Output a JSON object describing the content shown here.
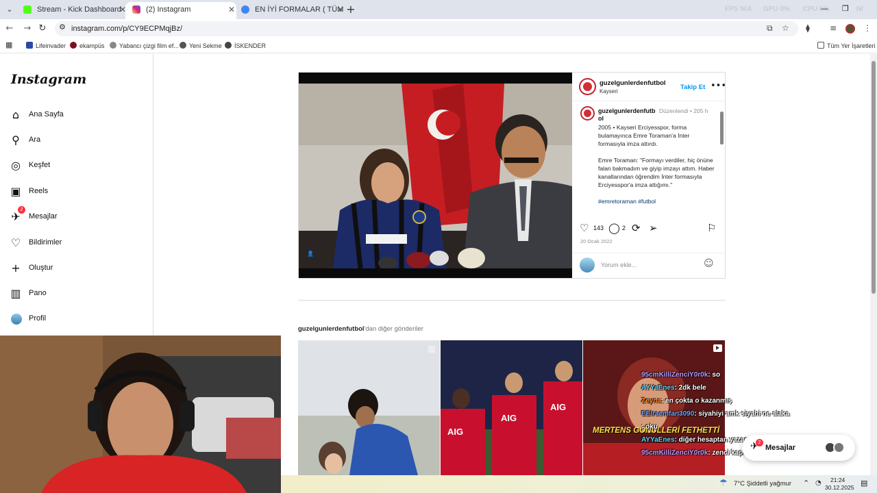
{
  "browser": {
    "tabs": [
      {
        "title": "Stream - Kick Dashboard",
        "active": false,
        "favicon_color": "#53fc18"
      },
      {
        "title": "(2) Instagram",
        "active": true,
        "favicon_color": "#d6249f"
      },
      {
        "title": "EN İYİ FORMALAR ( TÜM TAKIM",
        "active": false,
        "favicon_color": "#4285f4"
      }
    ],
    "sysmon": {
      "fps_label": "FPS",
      "fps": "N/A",
      "gpu_label": "GPU",
      "gpu": "0%",
      "cpu_label": "CPU",
      "cpu": "6%",
      "extra": "N/"
    },
    "url": "instagram.com/p/CY9ECPMqjBz/",
    "bookmarks": [
      "Lifeinvader",
      "ekampüs",
      "Yabancı çizgi film ef...",
      "Yeni Sekme",
      "İSKENDER"
    ],
    "all_bookmarks": "Tüm Yer İşaretleri"
  },
  "sidebar": {
    "logo": "Instagram",
    "items": [
      {
        "label": "Ana Sayfa",
        "icon": "home-icon",
        "glyph": "⌂"
      },
      {
        "label": "Ara",
        "icon": "search-icon",
        "glyph": "⚲"
      },
      {
        "label": "Keşfet",
        "icon": "compass-icon",
        "glyph": "◎"
      },
      {
        "label": "Reels",
        "icon": "reels-icon",
        "glyph": "▣"
      },
      {
        "label": "Mesajlar",
        "icon": "messenger-icon",
        "glyph": "✈",
        "badge": "2"
      },
      {
        "label": "Bildirimler",
        "icon": "heart-icon",
        "glyph": "♡"
      },
      {
        "label": "Oluştur",
        "icon": "plus-icon",
        "glyph": "+"
      },
      {
        "label": "Pano",
        "icon": "dashboard-icon",
        "glyph": "▥"
      },
      {
        "label": "Profil",
        "icon": "profile-avatar",
        "glyph": ""
      }
    ]
  },
  "post": {
    "username": "guzelgunlerdenfutbol",
    "location": "Kayseri",
    "follow": "Takip Et",
    "caption_user": "guzelgunlerdenfutbol",
    "caption_edited": "Düzenlendi",
    "caption_age": "205 h",
    "caption": "2005 • Kayseri Erciyesspor, forma bulamayınca Emre Toraman'a İnter formasıyla imza attırdı.\n\nEmre Toraman: \"Formayı verdiler, hiç önüne falan bakmadım ve giyip imzayı attım. Haber kanallarından öğrendim İnter formasıyla Erciyesspor'a imza attığımı.\"",
    "tags": "#emretoraman #futbol",
    "likes": "143",
    "comments": "2",
    "date": "20 Ocak 2022",
    "comment_placeholder": "Yorum ekle..."
  },
  "more": {
    "user": "guzelgunlerdenfutbol",
    "suffix": "'dan diğer gönderiler"
  },
  "chat": [
    {
      "user": "95cmKilliZenciY0r0k",
      "msg": ": so",
      "color": "#b69cff"
    },
    {
      "user": "AYYaEnes",
      "msg": ": 2dk bele",
      "color": "#5fd3ff"
    },
    {
      "user": "Zeyna",
      "msg": ": en çokta o kazanmış",
      "color": "#ff8c2e"
    },
    {
      "user": "EElraemfan3090",
      "msg": ": siyahiyi amk siyahi ne alaka",
      "color": "#7aa2ff"
    },
    {
      "user": "",
      "msg": ": oku",
      "color": "#ffd34e"
    },
    {
      "user": "AYYaEnes",
      "msg": ": diğer hesaptan yazacaktım",
      "color": "#5fd3ff"
    },
    {
      "user": "95cmKilliZenciY0r0k",
      "msg": ": zenci kapışması olur",
      "color": "#b69cff"
    }
  ],
  "messages_pill": {
    "label": "Mesajlar",
    "badge": "2"
  },
  "taskbar": {
    "weather": "7°C  Şiddetli yağmur",
    "time": "21:24",
    "date": "30.12.2025"
  },
  "tile3_caption": "MERTENS GÖNÜLLERİ FETHETTİ"
}
